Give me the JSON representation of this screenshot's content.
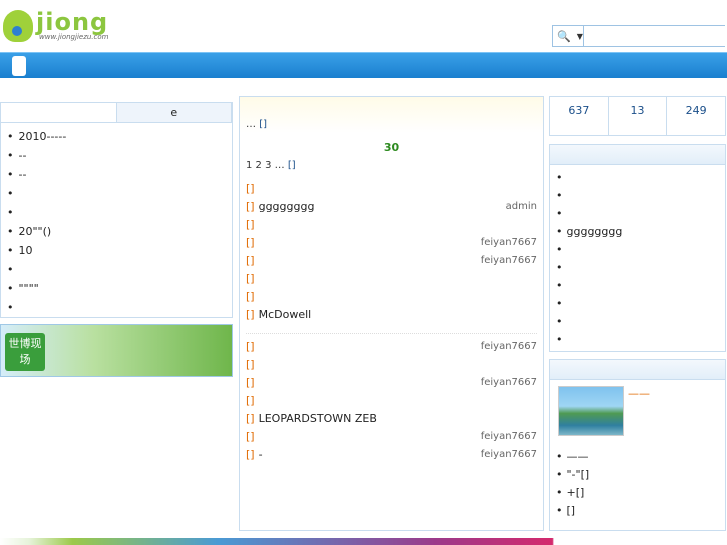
{
  "header": {
    "logo_text": "jiong",
    "logo_url": "www.jiongjiezu.com",
    "top_links": [
      "",
      "",
      ""
    ]
  },
  "search": {
    "select_label": "",
    "placeholder": ""
  },
  "nav": {
    "items": [
      "",
      "",
      "",
      "",
      "",
      ""
    ]
  },
  "left": {
    "tabs": [
      "",
      "e"
    ],
    "items": [
      "2010-----",
      "--",
      "--",
      "",
      "",
      "20\"\"()",
      "10",
      "",
      "\"\"\"\"",
      ""
    ],
    "banner_text": "世博现场"
  },
  "center": {
    "headline": "",
    "headline_summary": "          ",
    "more": "[]",
    "section_title": "30",
    "section_summary": "1 2 3",
    "news": [
      {
        "cat": "[]",
        "title": "",
        "author": ""
      },
      {
        "cat": "[]",
        "title": "gggggggg",
        "author": "admin"
      },
      {
        "cat": "[]",
        "title": "",
        "author": ""
      },
      {
        "cat": "[]",
        "title": "",
        "author": "feiyan7667"
      },
      {
        "cat": "[]",
        "title": "",
        "author": "feiyan7667"
      },
      {
        "cat": "[]",
        "title": "",
        "author": ""
      },
      {
        "cat": "[]",
        "title": "",
        "author": ""
      },
      {
        "cat": "[]",
        "title": "McDowell",
        "author": ""
      },
      {
        "cat": "[]",
        "title": "",
        "author": "feiyan7667"
      },
      {
        "cat": "[]",
        "title": "",
        "author": ""
      },
      {
        "cat": "[]",
        "title": "",
        "author": "feiyan7667"
      },
      {
        "cat": "[]",
        "title": "",
        "author": ""
      },
      {
        "cat": "[]",
        "title": "LEOPARDSTOWN ZEB",
        "author": ""
      },
      {
        "cat": "[]",
        "title": "",
        "author": "feiyan7667"
      },
      {
        "cat": "[]",
        "title": "-",
        "author": "feiyan7667"
      }
    ]
  },
  "stats": [
    {
      "num": "637",
      "label": ""
    },
    {
      "num": "13",
      "label": ""
    },
    {
      "num": "249",
      "label": ""
    }
  ],
  "right": {
    "hot_title": "",
    "hot": [
      "",
      "",
      "",
      "gggggggg",
      "",
      "",
      "",
      "",
      "",
      ""
    ],
    "pic_title": "",
    "pic_caption": "——",
    "pic_list": [
      "——",
      "\"-\"[]",
      "+[]",
      "[]"
    ]
  }
}
